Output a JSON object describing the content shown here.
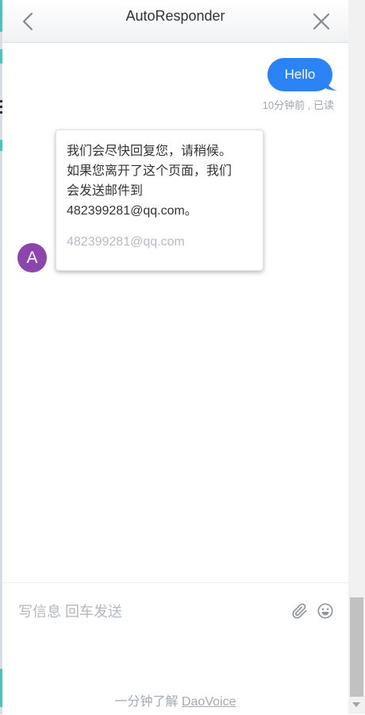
{
  "header": {
    "title": "AutoResponder"
  },
  "conversation": {
    "outgoing_message": "Hello",
    "outgoing_status": "10分钟前 , 已读",
    "agent_avatar_letter": "A",
    "auto_reply": {
      "line1": "我们会尽快回复您，请稍候。",
      "line2": "如果您离开了这个页面，我们",
      "line3": "会发送邮件到",
      "line4": "482399281@qq.com。",
      "email": "482399281@qq.com"
    }
  },
  "composer": {
    "placeholder": "写信息 回车发送",
    "value": ""
  },
  "footer": {
    "powered_prefix": "一分钟了解 ",
    "powered_link": "DaoVoice"
  },
  "colors": {
    "accent": "#2b83f6",
    "avatar": "#8b45ad",
    "muted_text": "#9ea6b0"
  },
  "icons": {
    "back": "chevron-left-icon",
    "close": "close-icon",
    "attach": "paperclip-icon",
    "emoji": "smiley-icon"
  }
}
